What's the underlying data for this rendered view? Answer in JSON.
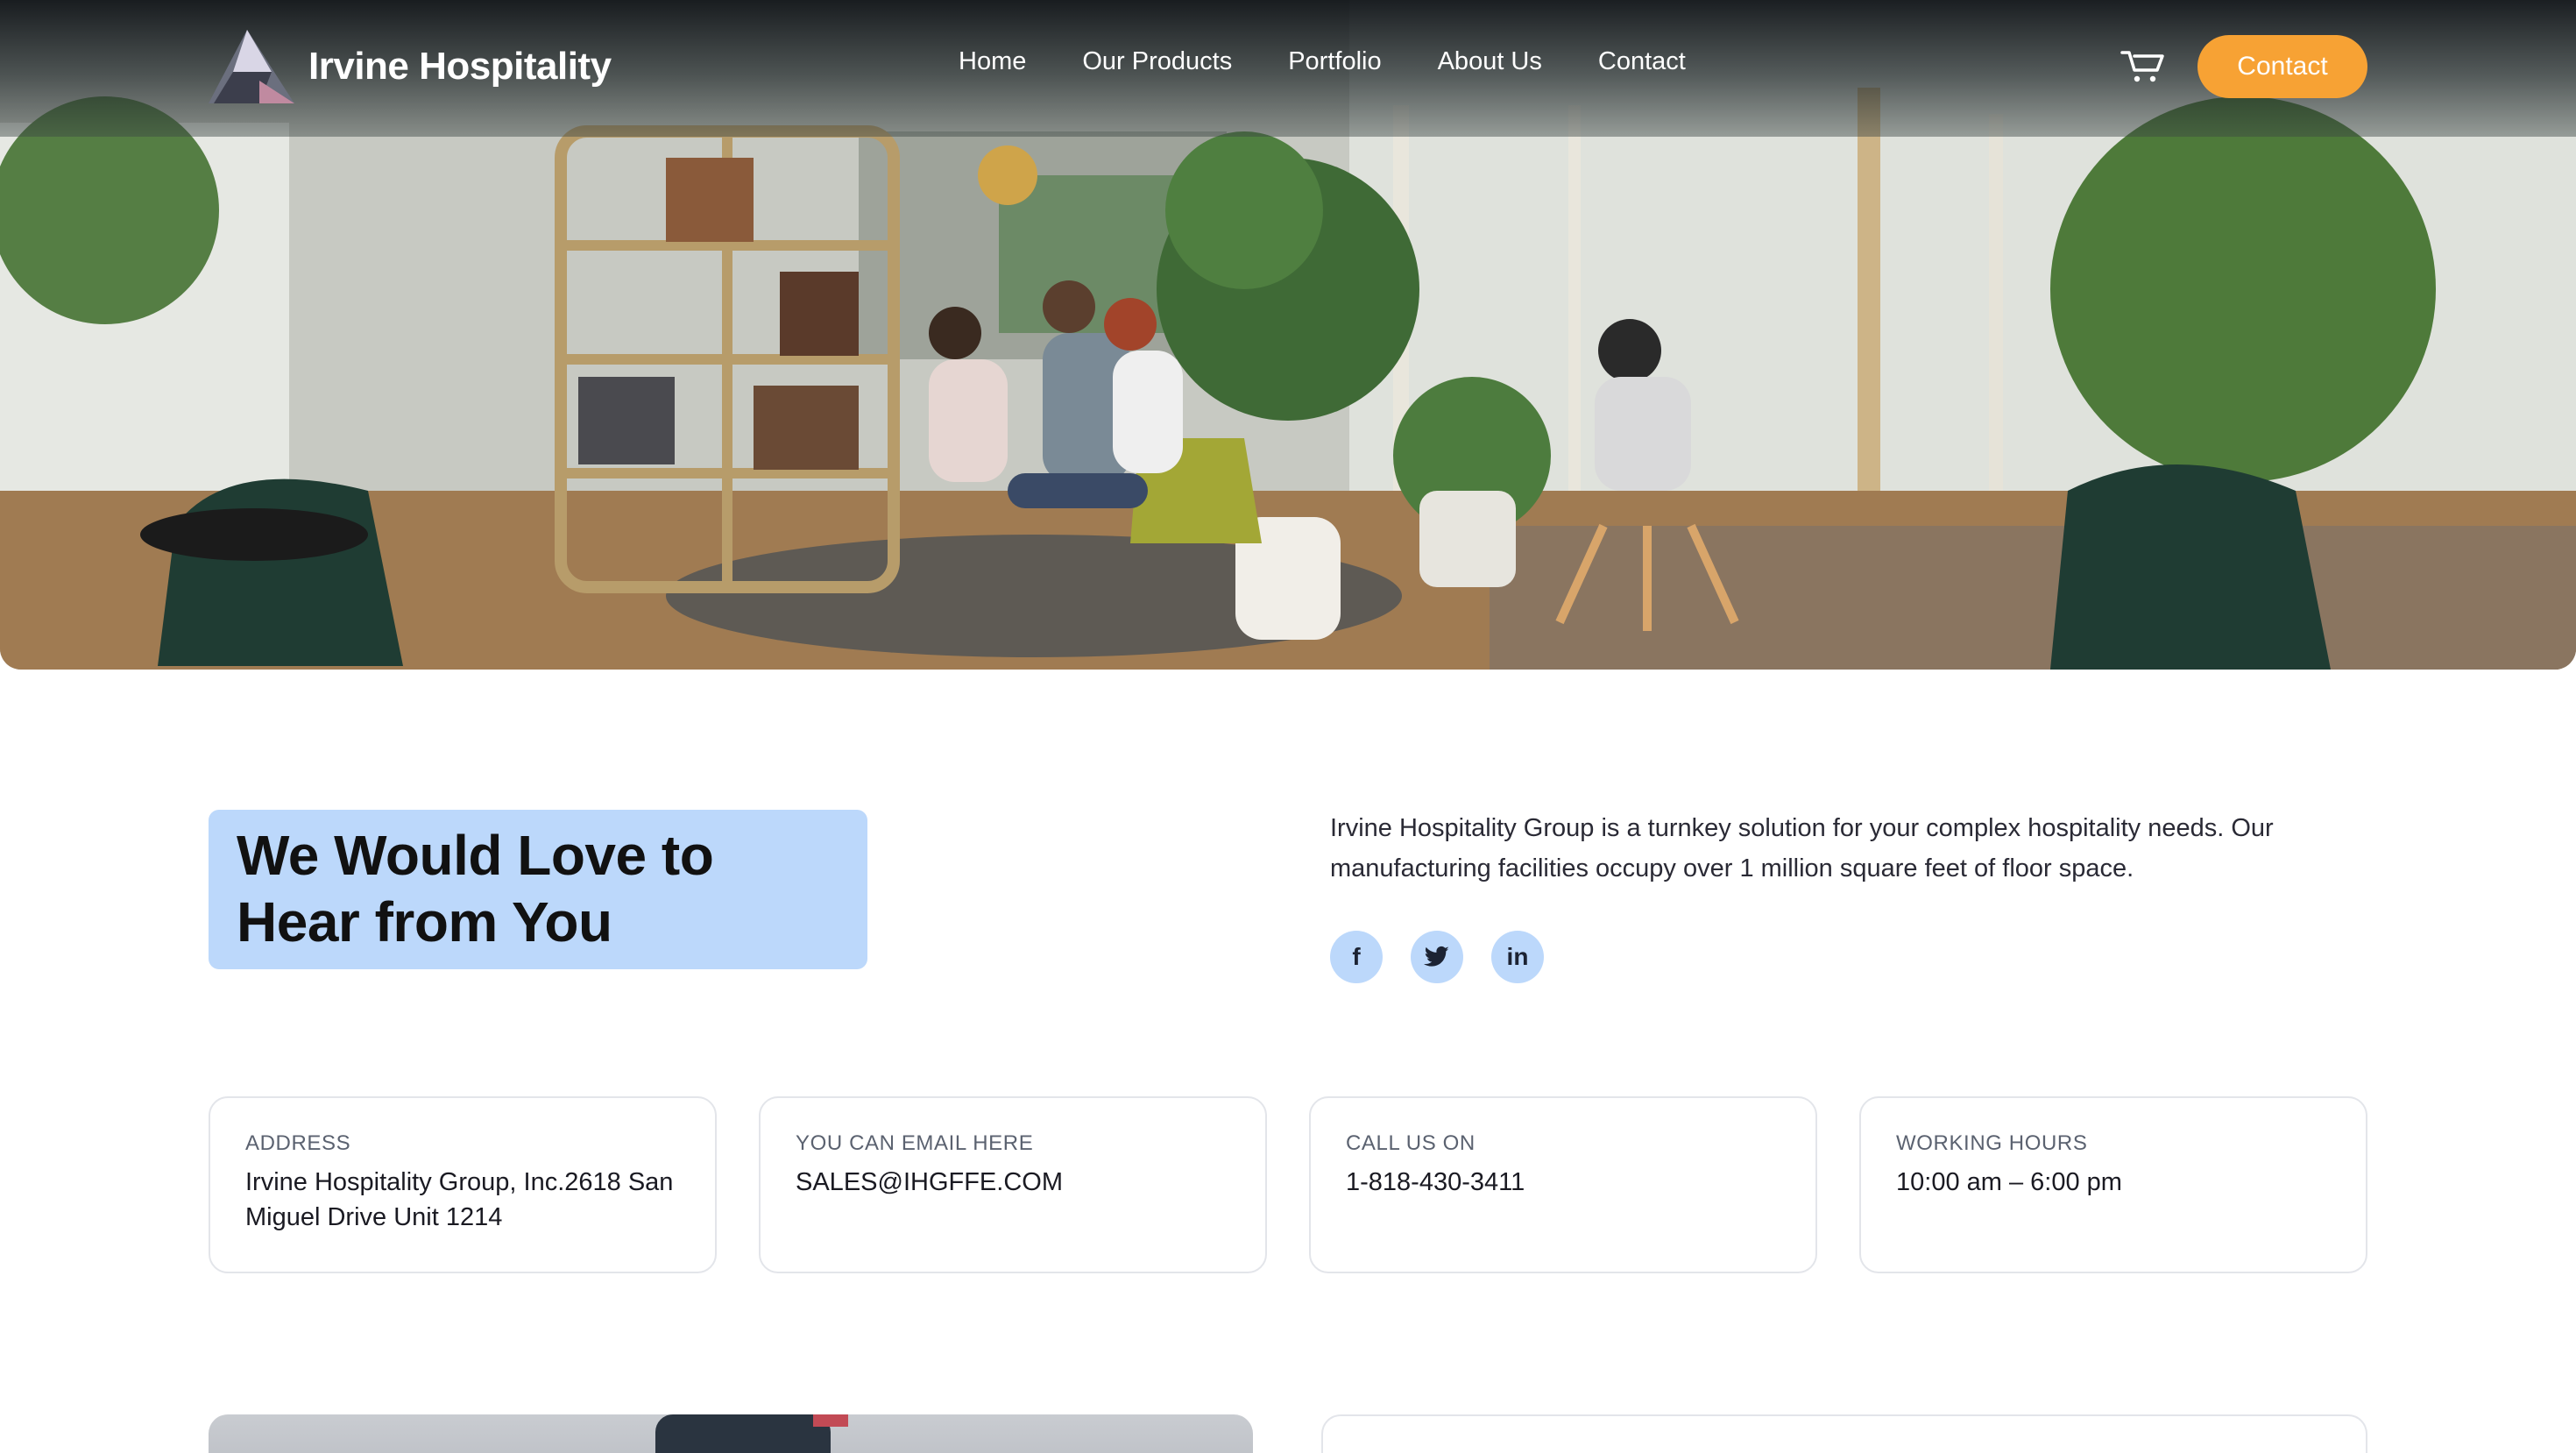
{
  "brand": {
    "name": "Irvine Hospitality",
    "logo_icon": "triangle-a-logo-icon"
  },
  "nav": {
    "items": [
      "Home",
      "Our Products",
      "Portfolio",
      "About Us",
      "Contact"
    ],
    "cart_icon": "cart-icon",
    "cta_label": "Contact",
    "cta_color": "#f7a234"
  },
  "hero": {
    "image": "office-lounge-photo"
  },
  "contact": {
    "heading": "We Would Love to Hear from You",
    "heading_bg": "#bcd8fb",
    "intro": "Irvine Hospitality Group is a turnkey solution for your complex hospitality needs. Our manufacturing facilities occupy over 1 million square feet of floor space.",
    "socials": [
      {
        "icon": "facebook-icon",
        "glyph": "f"
      },
      {
        "icon": "twitter-icon",
        "glyph": ""
      },
      {
        "icon": "linkedin-icon",
        "glyph": "in"
      }
    ]
  },
  "cards": [
    {
      "label": "ADDRESS",
      "value": "Irvine Hospitality Group, Inc.2618 San Miguel Drive Unit 1214"
    },
    {
      "label": "YOU CAN EMAIL HERE",
      "value": "SALES@IHGFFE.COM"
    },
    {
      "label": "CALL US ON",
      "value": "1-818-430-3411"
    },
    {
      "label": "WORKING HOURS",
      "value": "10:00 am – 6:00 pm"
    }
  ]
}
